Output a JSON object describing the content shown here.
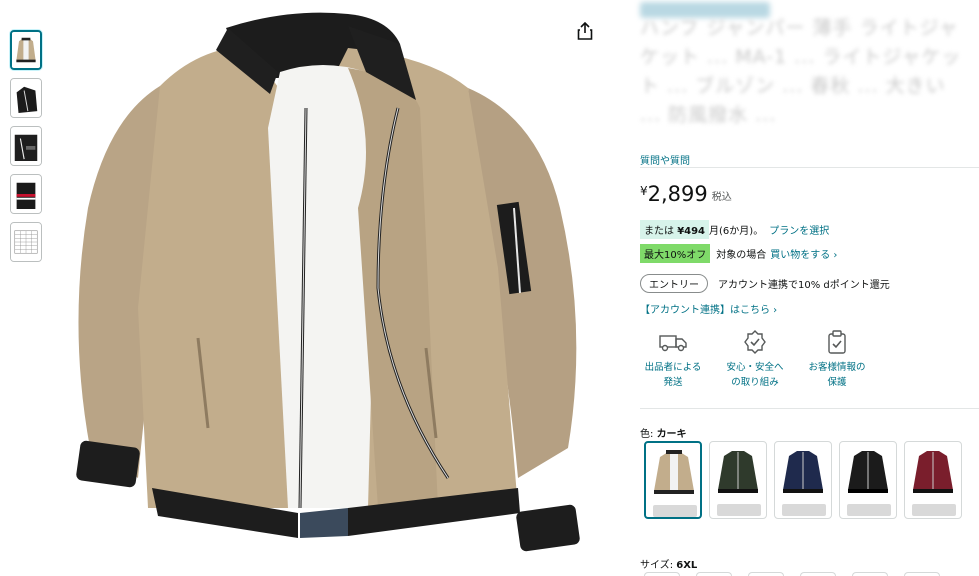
{
  "gallery": {
    "thumbnails": [
      "khaki-front",
      "black-side",
      "black-detail",
      "black-red-stripe",
      "size-chart"
    ],
    "selected_index": 0
  },
  "product": {
    "title_obscured": "ハンフ ジャンパー 薄手 ライトジャケット ... MA-1 ... ライトジャケット ... ブルゾン ... 春秋 ... 大きい ... 防風撥水 ...",
    "ask_link": "質問や質問",
    "price_symbol": "¥",
    "price": "2,899",
    "tax_label": "税込",
    "plan_prefix": "または",
    "plan_amount": "¥494",
    "plan_suffix": "月(6か月)。",
    "plan_link": "プランを選択",
    "points_badge": "最大10%オフ",
    "points_text": "対象の場合",
    "points_link": "買い物をする ›",
    "entry_pill": "エントリー",
    "entry_text": "アカウント連携で10% dポイント還元",
    "account_link": "【アカウント連携】はこちら ›"
  },
  "features": [
    {
      "icon": "truck-icon",
      "label": "出品者による発送"
    },
    {
      "icon": "badge-check-icon",
      "label": "安心・安全への取り組み"
    },
    {
      "icon": "clipboard-check-icon",
      "label": "お客様情報の保護"
    }
  ],
  "color": {
    "label": "色:",
    "value": "カーキ",
    "swatches": [
      {
        "name": "khaki",
        "hex": "#c2ad8c",
        "selected": true
      },
      {
        "name": "army-green",
        "hex": "#2f3a2c"
      },
      {
        "name": "navy",
        "hex": "#1f2a4d"
      },
      {
        "name": "black",
        "hex": "#1b1b1b"
      },
      {
        "name": "wine-red",
        "hex": "#7a1e2c"
      }
    ]
  },
  "size": {
    "label": "サイズ:",
    "value": "6XL"
  },
  "colors": {
    "link": "#007185",
    "plan_badge_bg": "#d7f3ea",
    "points_badge_bg": "#7fda69",
    "khaki": "#c2ad8c"
  }
}
